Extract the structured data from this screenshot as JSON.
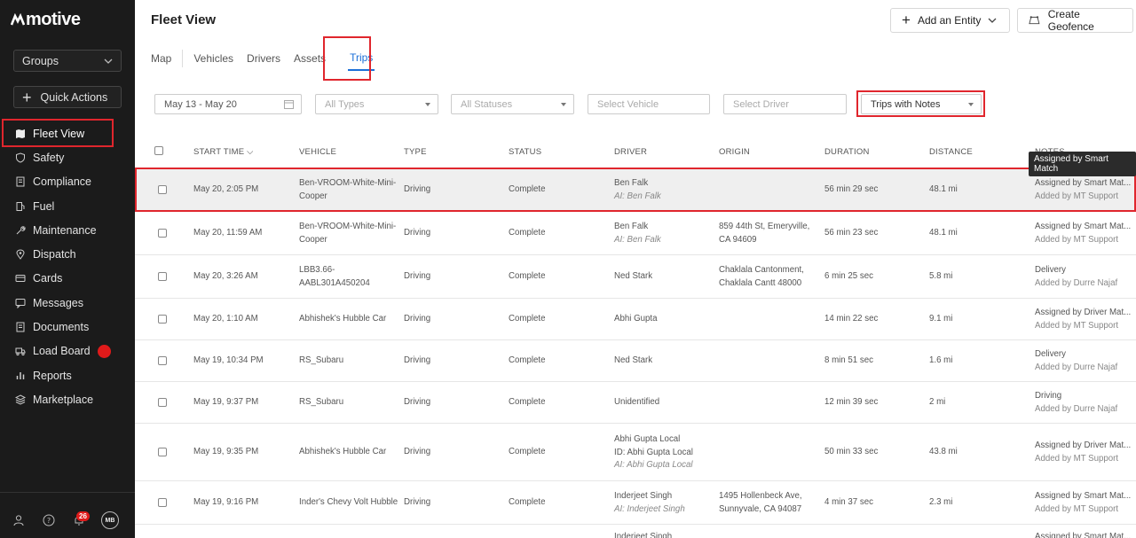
{
  "sidebar": {
    "logo": "motive",
    "groups_label": "Groups",
    "quick_actions_label": "Quick Actions",
    "items": [
      {
        "label": "Fleet View",
        "icon": "map-icon"
      },
      {
        "label": "Safety",
        "icon": "shield-icon"
      },
      {
        "label": "Compliance",
        "icon": "document-icon"
      },
      {
        "label": "Fuel",
        "icon": "fuel-icon"
      },
      {
        "label": "Maintenance",
        "icon": "wrench-icon"
      },
      {
        "label": "Dispatch",
        "icon": "location-pin-icon"
      },
      {
        "label": "Cards",
        "icon": "card-icon"
      },
      {
        "label": "Messages",
        "icon": "chat-icon"
      },
      {
        "label": "Documents",
        "icon": "document-icon"
      },
      {
        "label": "Load Board",
        "icon": "truck-icon"
      },
      {
        "label": "Reports",
        "icon": "chart-icon"
      },
      {
        "label": "Marketplace",
        "icon": "layers-icon"
      }
    ],
    "notification_count": "26",
    "avatar_initials": "MB"
  },
  "header": {
    "title": "Fleet View",
    "add_entity_label": "Add an Entity",
    "create_geofence_label": "Create Geofence"
  },
  "tabs": [
    "Map",
    "Vehicles",
    "Drivers",
    "Assets",
    "Trips"
  ],
  "filters": {
    "date": "May 13 - May 20",
    "types": "All Types",
    "statuses": "All Statuses",
    "vehicle": "Select Vehicle",
    "driver": "Select Driver",
    "notes": "Trips with Notes"
  },
  "table": {
    "columns": [
      "START TIME",
      "VEHICLE",
      "TYPE",
      "STATUS",
      "DRIVER",
      "ORIGIN",
      "DURATION",
      "DISTANCE",
      "NOTES"
    ],
    "tooltip": "Assigned by Smart Match",
    "rows": [
      {
        "start": "May 20, 2:05 PM",
        "vehicle": [
          "Ben-VROOM-White-Mini-",
          "Cooper"
        ],
        "type": "Driving",
        "status": "Complete",
        "driver": [
          "Ben Falk"
        ],
        "driver_ai": "AI: Ben Falk",
        "origin": [],
        "duration": "56 min 29 sec",
        "distance": "48.1 mi",
        "notes": "Assigned by Smart Mat...",
        "notes_by": "Added by MT Support"
      },
      {
        "start": "May 20, 11:59 AM",
        "vehicle": [
          "Ben-VROOM-White-Mini-",
          "Cooper"
        ],
        "type": "Driving",
        "status": "Complete",
        "driver": [
          "Ben Falk"
        ],
        "driver_ai": "AI: Ben Falk",
        "origin": [
          "859 44th St, Emeryville,",
          "CA 94609"
        ],
        "duration": "56 min 23 sec",
        "distance": "48.1 mi",
        "notes": "Assigned by Smart Mat...",
        "notes_by": "Added by MT Support"
      },
      {
        "start": "May 20, 3:26 AM",
        "vehicle": [
          "LBB3.66-",
          "AABL301A450204"
        ],
        "type": "Driving",
        "status": "Complete",
        "driver": [
          "Ned Stark"
        ],
        "driver_ai": "",
        "origin": [
          "Chaklala Cantonment,",
          "Chaklala Cantt 48000"
        ],
        "duration": "6 min 25 sec",
        "distance": "5.8 mi",
        "notes": "Delivery",
        "notes_by": "Added by Durre Najaf"
      },
      {
        "start": "May 20, 1:10 AM",
        "vehicle": [
          "Abhishek's Hubble Car"
        ],
        "type": "Driving",
        "status": "Complete",
        "driver": [
          "Abhi Gupta"
        ],
        "driver_ai": "",
        "origin": [],
        "duration": "14 min 22 sec",
        "distance": "9.1 mi",
        "notes": "Assigned by Driver Mat...",
        "notes_by": "Added by MT Support"
      },
      {
        "start": "May 19, 10:34 PM",
        "vehicle": [
          "RS_Subaru"
        ],
        "type": "Driving",
        "status": "Complete",
        "driver": [
          "Ned Stark"
        ],
        "driver_ai": "",
        "origin": [],
        "duration": "8 min 51 sec",
        "distance": "1.6 mi",
        "notes": "Delivery",
        "notes_by": "Added by Durre Najaf"
      },
      {
        "start": "May 19, 9:37 PM",
        "vehicle": [
          "RS_Subaru"
        ],
        "type": "Driving",
        "status": "Complete",
        "driver": [
          "Unidentified"
        ],
        "driver_ai": "",
        "origin": [],
        "duration": "12 min 39 sec",
        "distance": "2 mi",
        "notes": "Driving",
        "notes_by": "Added by Durre Najaf"
      },
      {
        "start": "May 19, 9:35 PM",
        "vehicle": [
          "Abhishek's Hubble Car"
        ],
        "type": "Driving",
        "status": "Complete",
        "driver": [
          "Abhi Gupta Local",
          "ID: Abhi Gupta Local"
        ],
        "driver_ai": "AI: Abhi Gupta Local",
        "origin": [],
        "duration": "50 min 33 sec",
        "distance": "43.8 mi",
        "notes": "Assigned by Driver Mat...",
        "notes_by": "Added by MT Support"
      },
      {
        "start": "May 19, 9:16 PM",
        "vehicle": [
          "Inder's Chevy Volt Hubble"
        ],
        "type": "Driving",
        "status": "Complete",
        "driver": [
          "Inderjeet Singh"
        ],
        "driver_ai": "AI: Inderjeet Singh",
        "origin": [
          "1495 Hollenbeck Ave,",
          "Sunnyvale, CA 94087"
        ],
        "duration": "4 min 37 sec",
        "distance": "2.3 mi",
        "notes": "Assigned by Smart Mat...",
        "notes_by": "Added by MT Support"
      },
      {
        "start": "",
        "vehicle": [],
        "type": "",
        "status": "",
        "driver": [
          "Inderjeet Singh"
        ],
        "driver_ai": "",
        "origin": [],
        "duration": "",
        "distance": "",
        "notes": "Assigned by Smart Mat...",
        "notes_by": ""
      }
    ]
  }
}
